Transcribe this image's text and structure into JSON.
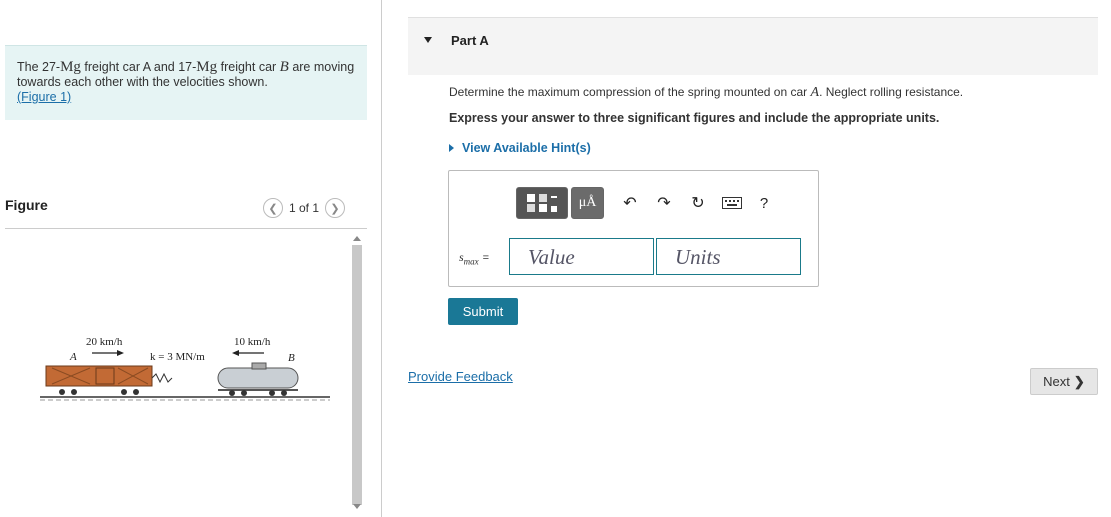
{
  "problem": {
    "t1": "The 27-",
    "mg1": "Mg",
    "t2": " freight car A and 17-",
    "mg2": "Mg",
    "t3": " freight car ",
    "carB": "B",
    "t4": " are moving towards each other with the velocities shown.",
    "figure_link": "(Figure 1)"
  },
  "figure": {
    "label": "Figure",
    "pager": "1 of 1",
    "prev_icon": "chevron-left-icon",
    "next_icon": "chevron-right-icon",
    "diagram": {
      "car_a_label": "A",
      "car_b_label": "B",
      "velocity_a": "20 km/h",
      "velocity_b": "10 km/h",
      "spring": "k = 3 MN/m"
    }
  },
  "part": {
    "title": "Part A",
    "question_pre": "Determine the maximum compression of the spring mounted on car ",
    "question_var": "A",
    "question_post": ". Neglect rolling resistance.",
    "instruction": "Express your answer to three significant figures and include the appropriate units.",
    "hint": "View Available Hint(s)"
  },
  "answer": {
    "var": "s",
    "var_sub": "max",
    "equals": "=",
    "value_placeholder": "Value",
    "units_placeholder": "Units",
    "units_button": "μÅ",
    "help": "?"
  },
  "buttons": {
    "submit": "Submit",
    "feedback": "Provide Feedback",
    "next": "Next",
    "next_icon": "chevron-right-icon"
  },
  "colors": {
    "link": "#1b6ea8",
    "submit_bg": "#1a7896",
    "problem_bg": "#e6f4f4",
    "input_border": "#1a7a8a"
  }
}
